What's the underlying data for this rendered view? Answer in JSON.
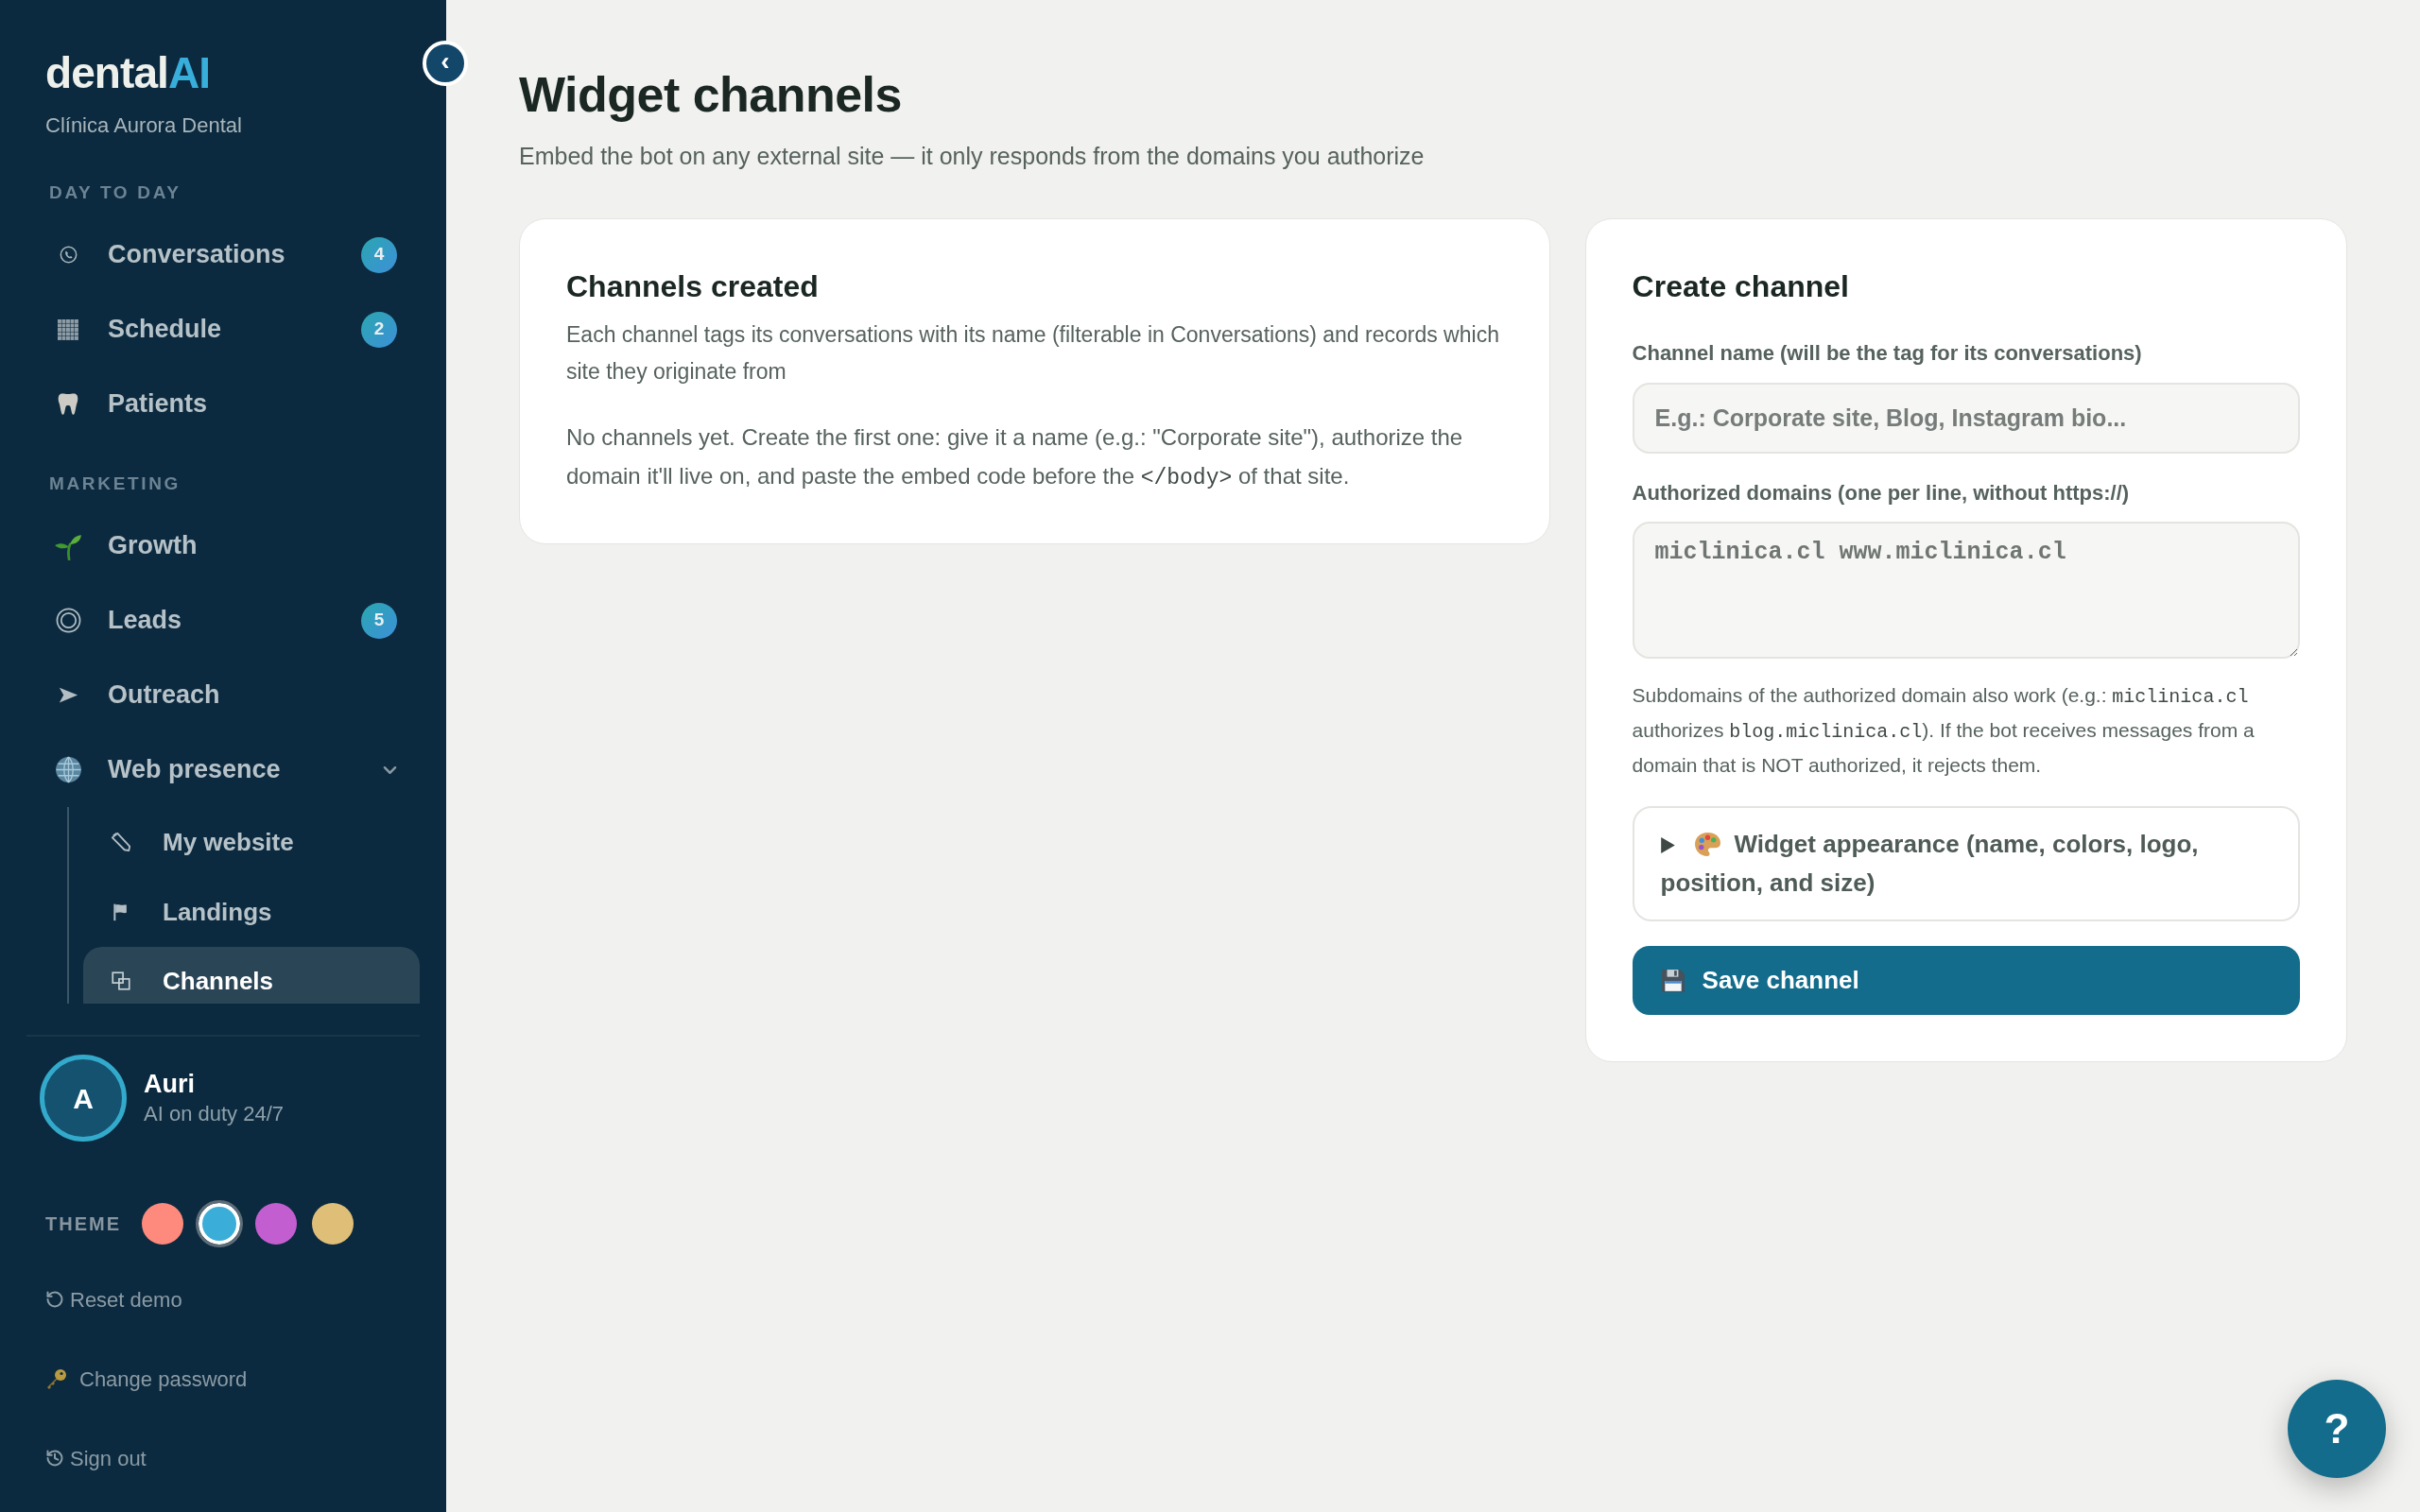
{
  "sidebar": {
    "logo": {
      "text": "dental",
      "accent": "AI"
    },
    "clinic": "Clínica Aurora Dental",
    "collapse_button": "‹",
    "sections": [
      {
        "heading": "DAY TO DAY",
        "items": [
          {
            "label": "Conversations",
            "badge": "4",
            "selected": false
          },
          {
            "label": "Schedule",
            "badge": "2",
            "selected": false
          },
          {
            "label": "Patients",
            "selected": false
          }
        ]
      },
      {
        "heading": "MARKETING",
        "items": [
          {
            "label": "Growth",
            "selected": false
          },
          {
            "label": "Leads",
            "badge": "5",
            "selected": false
          },
          {
            "label": "Outreach",
            "selected": false
          },
          {
            "label": "Web presence",
            "selected": false,
            "expanded": true,
            "children": [
              {
                "label": "My website",
                "selected": false
              },
              {
                "label": "Landings",
                "selected": false
              },
              {
                "label": "Channels",
                "selected": true
              }
            ]
          }
        ]
      }
    ],
    "assistant": {
      "initial": "A",
      "name": "Auri",
      "status": "AI on duty 24/7"
    },
    "theme": {
      "label": "THEME",
      "swatches": [
        {
          "color": "#fd8a7c",
          "selected": false
        },
        {
          "color": "#3aaed8",
          "selected": true
        },
        {
          "color": "#c35ed0",
          "selected": false
        },
        {
          "color": "#dfbe78",
          "selected": false
        }
      ]
    },
    "footer_links": [
      {
        "label": "Reset demo"
      },
      {
        "label": "Change password"
      },
      {
        "label": "Sign out"
      }
    ]
  },
  "page": {
    "title": "Widget channels",
    "subtitle": "Embed the bot on any external site — it only responds from the domains you authorize"
  },
  "channels_card": {
    "title": "Channels created",
    "description": "Each channel tags its conversations with its name (filterable in Conversations) and records which site they originate from",
    "empty_message": [
      {
        "kind": "text",
        "text": "No channels yet. Create the first one: give it a name (e.g.: \"Corporate site\"), authorize the domain it'll live on, and paste the embed code before the "
      },
      {
        "kind": "code",
        "text": "</body>"
      },
      {
        "kind": "text",
        "text": " of that site."
      }
    ]
  },
  "create_card": {
    "title": "Create channel",
    "name_field": {
      "label": "Channel name (will be the tag for its conversations)",
      "placeholder": "E.g.: Corporate site, Blog, Instagram bio..."
    },
    "domains_field": {
      "label": "Authorized domains (one per line, without https://)",
      "placeholder": "miclinica.cl www.miclinica.cl"
    },
    "domains_hint": [
      {
        "kind": "text",
        "text": "Subdomains of the authorized domain also work (e.g.: "
      },
      {
        "kind": "code",
        "text": "miclinica.cl"
      },
      {
        "kind": "text",
        "text": " authorizes "
      },
      {
        "kind": "code",
        "text": "blog.miclinica.cl"
      },
      {
        "kind": "text",
        "text": "). If the bot receives messages from a domain that is NOT authorized, it rejects them."
      }
    ],
    "appearance": {
      "label": "Widget appearance (name, colors, logo, position, and size)",
      "expanded": false
    },
    "save_button": "Save channel"
  },
  "help_button": "?"
}
